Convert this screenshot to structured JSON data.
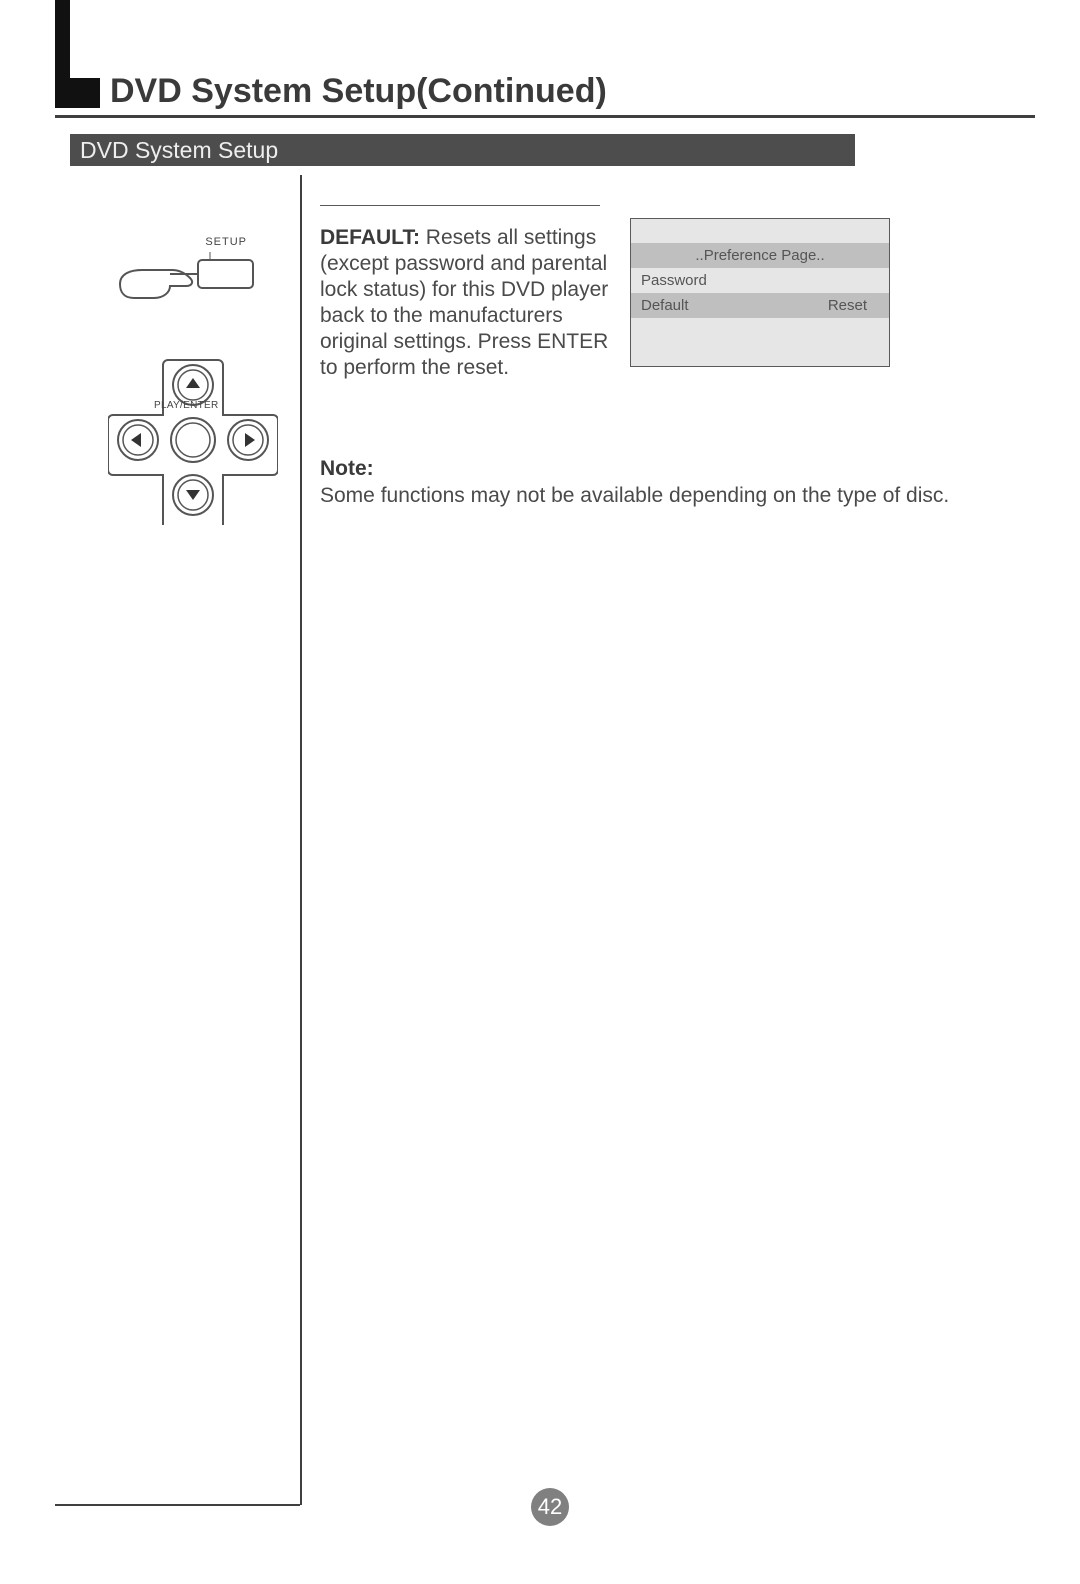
{
  "title": "DVD System Setup(Continued)",
  "section_bar": "DVD System Setup",
  "setup_button_label": "SETUP",
  "dpad_label": "PLAY/ENTER",
  "entry": {
    "term": "DEFAULT:",
    "body": "Resets all settings (except password and parental lock status) for this DVD player back to the manufacturers original settings. Press ENTER to perform the reset."
  },
  "note": {
    "heading": "Note:",
    "body": "Some functions may not be available depending on the type of disc."
  },
  "menu": {
    "header": "..Preference Page..",
    "rows": [
      {
        "label": "Password",
        "value": ""
      },
      {
        "label": "Default",
        "value": "Reset"
      }
    ]
  },
  "page_number": "42"
}
